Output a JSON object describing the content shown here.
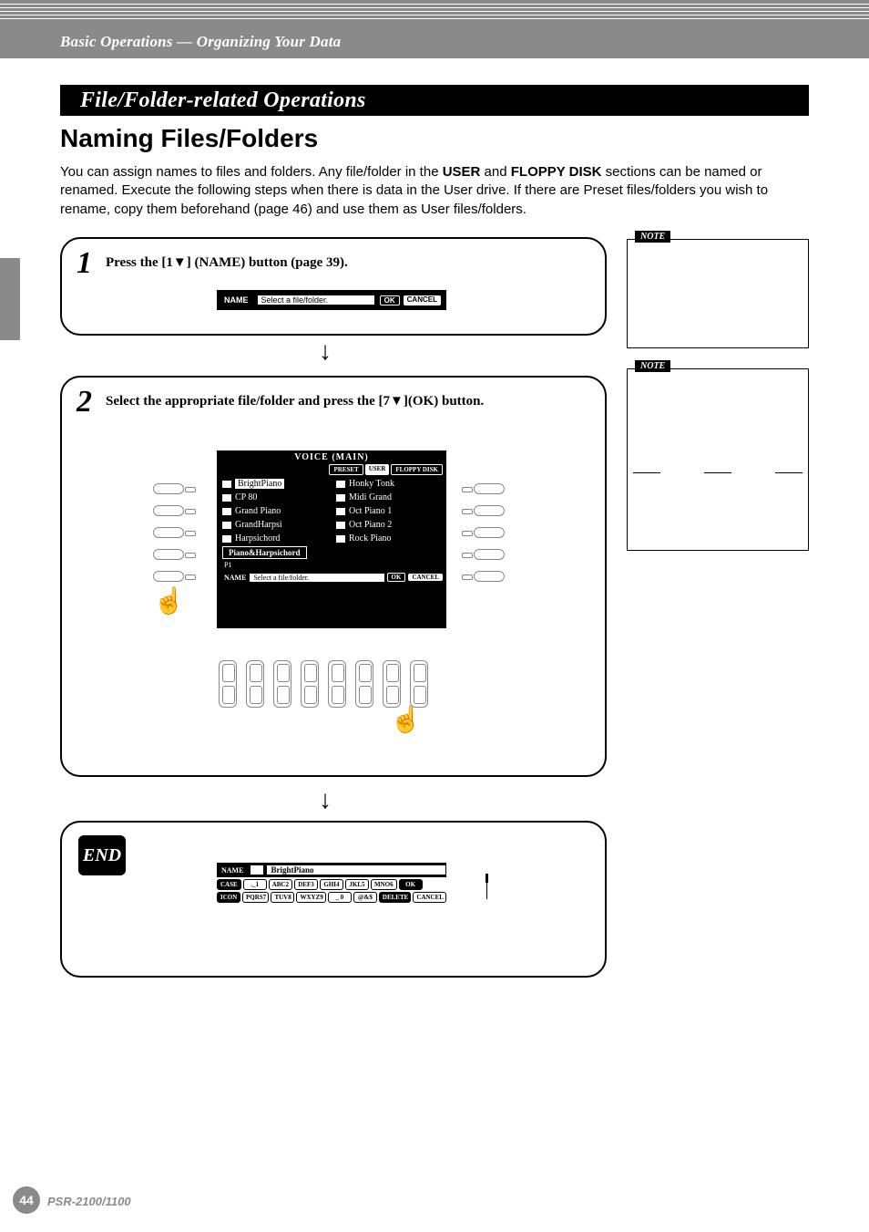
{
  "breadcrumb": "Basic Operations — Organizing Your Data",
  "banner": "File/Folder-related Operations",
  "h2": "Naming Files/Folders",
  "intro_parts": {
    "a": "You can assign names to files and folders. Any file/folder in the ",
    "b": "USER",
    "c": " and ",
    "d": "FLOPPY DISK",
    "e": " sections can be named or renamed. Execute the following steps when there is data in the User drive. If there are Preset files/folders you wish to rename, copy them beforehand (page 46) and use them as User files/folders."
  },
  "steps": {
    "s1_num": "1",
    "s1_text": "Press the [1▼] (NAME) button (page 39).",
    "s2_num": "2",
    "s2_text": "Select the appropriate file/folder and press the [7▼](OK) button.",
    "end_label": "END"
  },
  "lcd_name_bar": {
    "label": "NAME",
    "field": "Select a file/folder.",
    "ok": "OK",
    "cancel": "CANCEL"
  },
  "voice_main": {
    "title": "VOICE (MAIN)",
    "tabs": {
      "preset": "PRESET",
      "user": "USER",
      "floppy": "FLOPPY DISK"
    },
    "left_col": [
      "BrightPiano",
      "CP 80",
      "Grand Piano",
      "GrandHarpsi",
      "Harpsichord"
    ],
    "right_col": [
      "Honky Tonk",
      "Midi Grand",
      "Oct Piano 1",
      "Oct Piano 2",
      "Rock Piano"
    ],
    "category": "Piano&Harpsichord",
    "page_indicator": "P1",
    "bottombar": {
      "label": "NAME",
      "field": "Select a file/folder.",
      "ok": "OK",
      "cancel": "CANCEL"
    }
  },
  "keypad": {
    "label": "NAME",
    "namefield": "BrightPiano",
    "row_top": [
      "CASE",
      "._1",
      "ABC2",
      "DEF3",
      "GHI4",
      "JKL5",
      "MNO6",
      "OK"
    ],
    "row_bottom": [
      "ICON",
      "PQRS7",
      "TUV8",
      "WXYZ9",
      "_ 0",
      "@&$",
      "DELETE",
      "CANCEL"
    ]
  },
  "notes": {
    "label": "NOTE"
  },
  "footer": {
    "page_number": "44",
    "model": "PSR-2100/1100"
  },
  "arrows": {
    "down": "↓"
  }
}
